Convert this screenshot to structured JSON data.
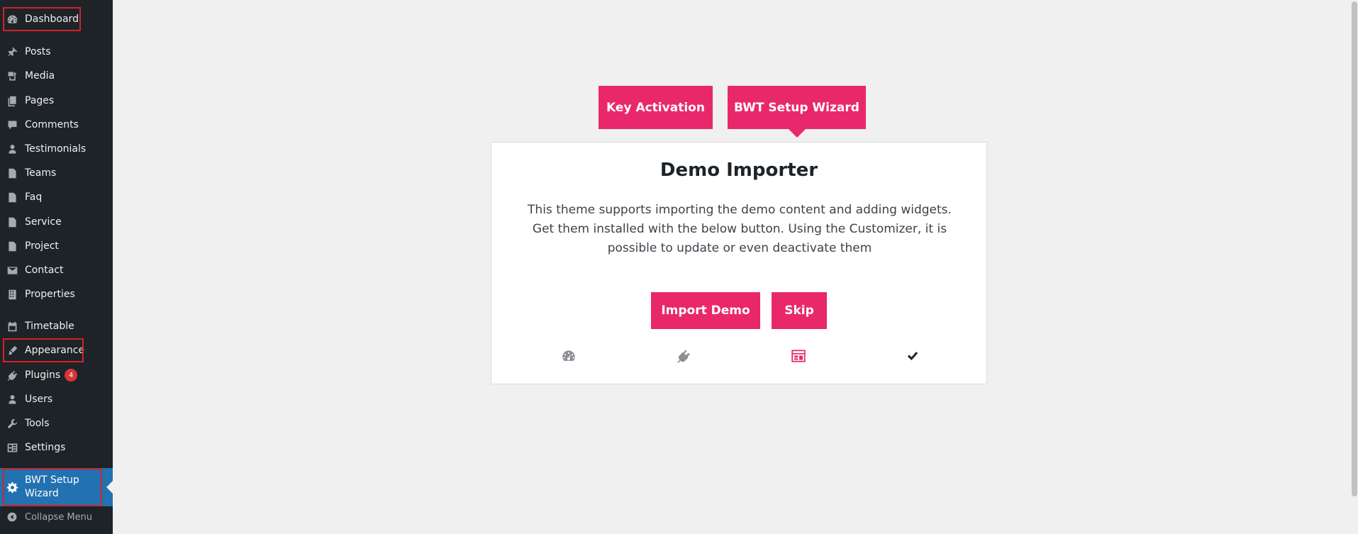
{
  "sidebar": {
    "items": [
      {
        "label": "Dashboard",
        "icon": "dashboard-icon"
      },
      {
        "label": "Posts",
        "icon": "pin-icon"
      },
      {
        "label": "Media",
        "icon": "media-icon"
      },
      {
        "label": "Pages",
        "icon": "pages-icon"
      },
      {
        "label": "Comments",
        "icon": "comment-icon"
      },
      {
        "label": "Testimonials",
        "icon": "person-icon"
      },
      {
        "label": "Teams",
        "icon": "document-icon"
      },
      {
        "label": "Faq",
        "icon": "document-icon"
      },
      {
        "label": "Service",
        "icon": "document-icon"
      },
      {
        "label": "Project",
        "icon": "document-icon"
      },
      {
        "label": "Contact",
        "icon": "envelope-icon"
      },
      {
        "label": "Properties",
        "icon": "building-icon"
      },
      {
        "label": "Timetable",
        "icon": "calendar-icon"
      },
      {
        "label": "Appearance",
        "icon": "paintbrush-icon"
      },
      {
        "label": "Plugins",
        "icon": "plugin-icon",
        "badge": "4"
      },
      {
        "label": "Users",
        "icon": "users-icon"
      },
      {
        "label": "Tools",
        "icon": "wrench-icon"
      },
      {
        "label": "Settings",
        "icon": "settings-icon"
      }
    ],
    "active_item": {
      "label": "BWT Setup Wizard",
      "icon": "gear-icon"
    },
    "collapse_label": "Collapse Menu"
  },
  "wizard": {
    "tabs": [
      {
        "label": "Key Activation"
      },
      {
        "label": "BWT Setup Wizard"
      }
    ],
    "title": "Demo Importer",
    "description": "This theme supports importing the demo content and adding widgets. Get them installed with the below button. Using the Customizer, it is possible to update or even deactivate them",
    "import_label": "Import Demo",
    "skip_label": "Skip",
    "steps": [
      {
        "icon": "dashboard-icon",
        "state": "done"
      },
      {
        "icon": "plugin-icon",
        "state": "done"
      },
      {
        "icon": "widgets-icon",
        "state": "current"
      },
      {
        "icon": "checkmark-icon",
        "state": "pending"
      }
    ]
  },
  "colors": {
    "sidebar_bg": "#1d2327",
    "active_bg": "#2271b1",
    "accent": "#e9286b",
    "highlight_outline": "#d2232a",
    "page_bg": "#f0f0f1"
  }
}
